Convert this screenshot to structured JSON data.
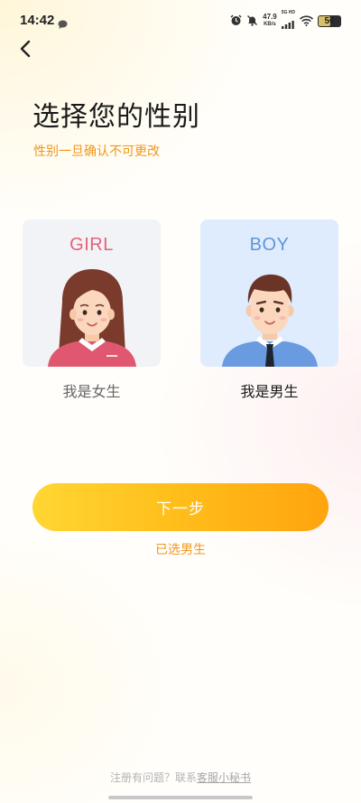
{
  "status_bar": {
    "time": "14:42",
    "net_speed_value": "47.9",
    "net_speed_unit": "KB/s",
    "signal_label": "5G HD",
    "battery": "56",
    "battery_level": 0.56
  },
  "header": {
    "title": "选择您的性别",
    "subtitle": "性别一旦确认不可更改"
  },
  "options": {
    "female": {
      "card_title": "GIRL",
      "label": "我是女生"
    },
    "male": {
      "card_title": "BOY",
      "label": "我是男生"
    }
  },
  "actions": {
    "next_label": "下一步",
    "selection_status": "已选男生"
  },
  "footer": {
    "help_text": "注册有问题？联系",
    "help_link": "客服小秘书"
  },
  "colors": {
    "accent_orange": "#f0961c",
    "button_gradient_start": "#ffd633",
    "button_gradient_end": "#ffa40e",
    "girl_pink": "#e6607a",
    "boy_blue": "#5f95d8"
  }
}
